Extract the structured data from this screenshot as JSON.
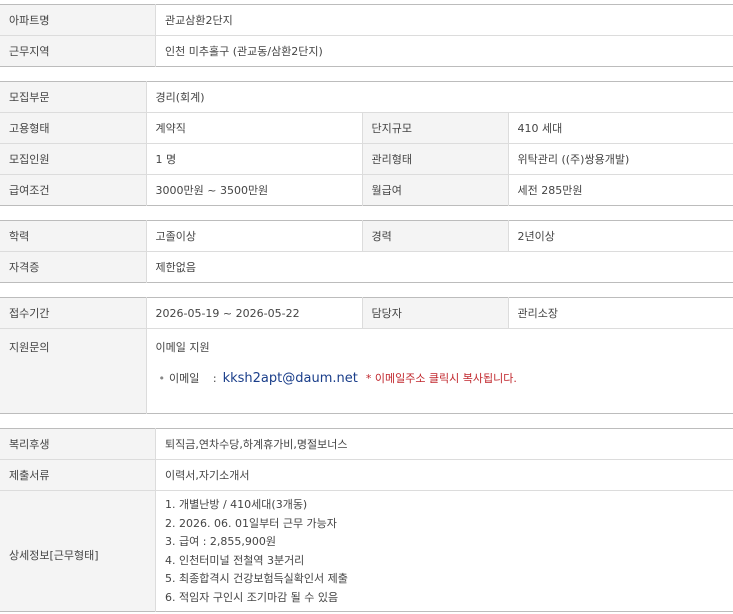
{
  "apartment": {
    "label": "아파트명",
    "value": "관교삼환2단지"
  },
  "workplace": {
    "label": "근무지역",
    "value": "인천 미추홀구 (관교동/삼환2단지)"
  },
  "recruit": {
    "field": {
      "label": "모집부문",
      "value": "경리(회계)"
    },
    "employment_type": {
      "label": "고용형태",
      "value": "계약직"
    },
    "complex_size": {
      "label": "단지규모",
      "value": "410 세대"
    },
    "headcount": {
      "label": "모집인원",
      "value": "1 명"
    },
    "management_type": {
      "label": "관리형태",
      "value": "위탁관리 ((주)쌍용개발)"
    },
    "salary": {
      "label": "급여조건",
      "value": "3000만원 ~ 3500만원"
    },
    "monthly_pay": {
      "label": "월급여",
      "value": "세전 285만원"
    }
  },
  "qualification": {
    "education": {
      "label": "학력",
      "value": "고졸이상"
    },
    "experience": {
      "label": "경력",
      "value": "2년이상"
    },
    "certificate": {
      "label": "자격증",
      "value": "제한없음"
    }
  },
  "application": {
    "period": {
      "label": "접수기간",
      "value": "2026-05-19 ~ 2026-05-22"
    },
    "manager": {
      "label": "담당자",
      "value": "관리소장"
    },
    "inquiry": {
      "label": "지원문의",
      "method": "이메일 지원",
      "bullet": "•",
      "email_label": "이메일",
      "email_sep": ":",
      "email": "kksh2apt@daum.net",
      "copy_note": "* 이메일주소 클릭시 복사됩니다."
    }
  },
  "benefits": {
    "welfare": {
      "label": "복리후생",
      "value": "퇴직금,연차수당,하계휴가비,명절보너스"
    },
    "documents": {
      "label": "제출서류",
      "value": "이력서,자기소개서"
    },
    "details": {
      "label": "상세정보[근무형태]",
      "lines": [
        "1. 개별난방 / 410세대(3개동)",
        "2. 2026. 06. 01일부터 근무 가능자",
        "3. 급여 : 2,855,900원",
        "4. 인천터미널 전철역 3분거리",
        "5. 최종합격시 건강보험득실확인서 제출",
        "6. 적임자 구인시 조기마감 될 수 있음"
      ]
    }
  }
}
